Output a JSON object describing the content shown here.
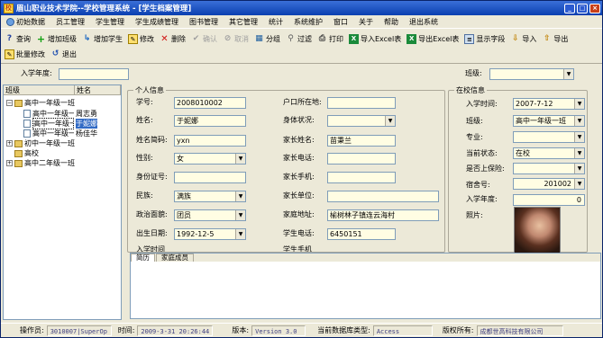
{
  "window": {
    "title": "眉山职业技术学院--学校管理系统 - [学生档案管理]",
    "app_icon": "school-app-icon"
  },
  "menu": [
    "初始数据",
    "员工管理",
    "学生管理",
    "学生成绩管理",
    "图书管理",
    "其它管理",
    "统计",
    "系统维护",
    "窗口",
    "关于",
    "帮助",
    "退出系统"
  ],
  "toolbar1": {
    "query": "查询",
    "add_class": "增加班级",
    "add_student": "增加学生",
    "edit": "修改",
    "delete": "删除",
    "confirm": "确认",
    "cancel": "取消",
    "group": "分组",
    "filter": "过滤",
    "print": "打印",
    "import_excel": "导入Excel表",
    "export_excel": "导出Excel表",
    "show_fields": "显示字段",
    "import": "导入",
    "export": "导出"
  },
  "toolbar2": {
    "batch_edit": "批量修改",
    "exit": "退出"
  },
  "filter": {
    "year_label": "入学年度:",
    "year_value": "",
    "class_label": "班级:",
    "class_value": ""
  },
  "tree": {
    "col1": "班级",
    "col2": "姓名",
    "nodes": [
      {
        "label": "高中一年级一班",
        "name": ""
      },
      {
        "label": "高中一年级一",
        "name": "周志勇"
      },
      {
        "label": "高中一年级一",
        "name": "于妮娜"
      },
      {
        "label": "高中一年级一",
        "name": "杨佳华"
      },
      {
        "label": "初中一年级一班",
        "name": ""
      },
      {
        "label": "高校",
        "name": ""
      },
      {
        "label": "高中二年级一班",
        "name": ""
      }
    ]
  },
  "personal": {
    "group_title": "个人信息",
    "student_id_label": "学号:",
    "student_id": "2008010002",
    "name_label": "姓名:",
    "name": "于妮娜",
    "name_abbr_label": "姓名简码:",
    "name_abbr": "yxn",
    "gender_label": "性别:",
    "gender": "女",
    "id_card_label": "身份证号:",
    "id_card": "",
    "ethnicity_label": "民族:",
    "ethnicity": "满族",
    "politics_label": "政治面貌:",
    "politics": "团员",
    "birth_label": "出生日期:",
    "birth": "1992-12-5",
    "enroll_time_label": "入学时间",
    "hukou_label": "户口所在地:",
    "hukou": "",
    "health_label": "身体状况:",
    "health": "",
    "parent_name_label": "家长姓名:",
    "parent_name": "苗秉兰",
    "parent_phone_label": "家长电话:",
    "parent_phone": "",
    "parent_mobile_label": "家长手机:",
    "parent_mobile": "",
    "parent_work_label": "家长单位:",
    "parent_work": "",
    "home_addr_label": "家庭地址:",
    "home_addr": "榆树林子镇连云海村",
    "student_phone_label": "学生电话:",
    "student_phone": "6450151",
    "student_mobile_label": "学生手机"
  },
  "school": {
    "group_title": "在校信息",
    "enroll_time_label": "入学时间:",
    "enroll_time": "2007-7-12",
    "class_label": "班级:",
    "class": "高中一年级一班",
    "major_label": "专业:",
    "major": "",
    "status_label": "当前状态:",
    "status": "在校",
    "insured_label": "是否上保险:",
    "insured": "",
    "dorm_label": "宿舍号:",
    "dorm": "201002",
    "year_label": "入学年度:",
    "year": "0",
    "photo_label": "照片:"
  },
  "tabs": [
    "简历",
    "家庭成员"
  ],
  "status": {
    "operator_label": "操作员:",
    "operator": "3010007|SuperOp",
    "time_label": "时间:",
    "time": "2009-3-31 20:26:44",
    "version_label": "版本:",
    "version": "Version 3.0",
    "db_label": "当前数据库类型:",
    "db": "Access",
    "copyright_label": "版权所有:",
    "copyright": "成都世高科技有限公司"
  }
}
